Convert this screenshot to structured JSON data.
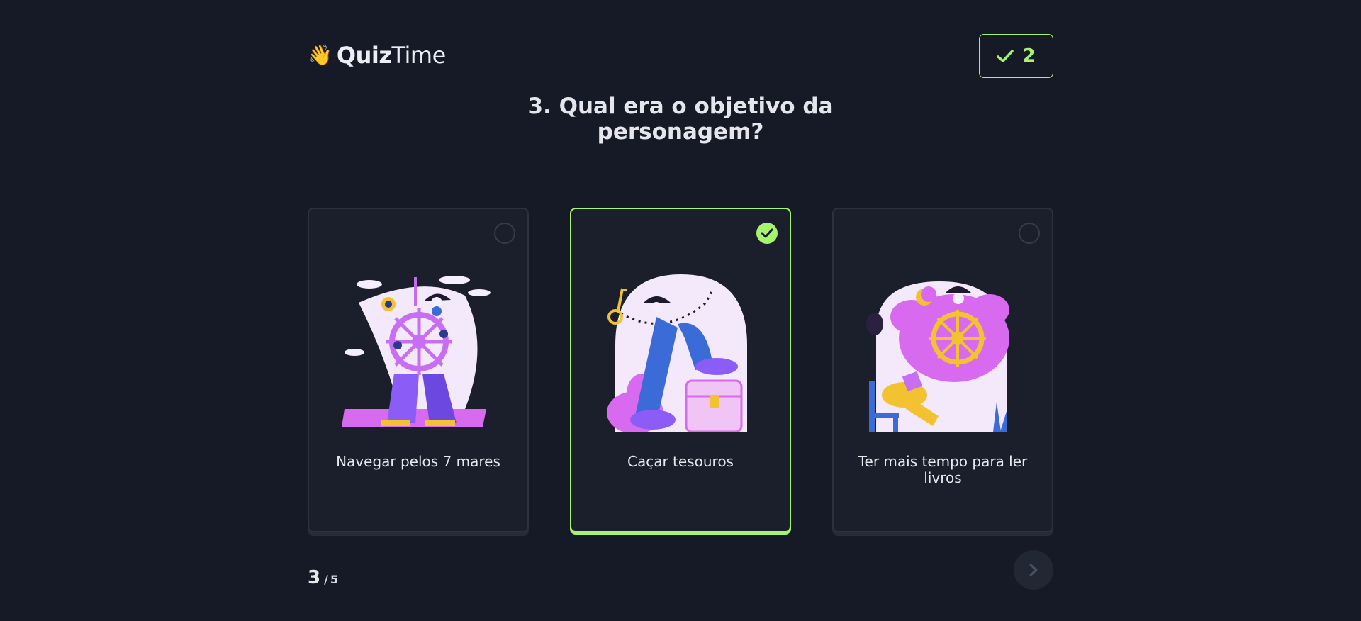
{
  "header": {
    "logo_emoji": "👋",
    "logo_bold": "Quiz",
    "logo_regular": "Time",
    "score_count": "2"
  },
  "question": {
    "text": "3. Qual era o objetivo da personagem?"
  },
  "options": [
    {
      "label": "Navegar pelos 7 mares",
      "selected": false,
      "illustration": "pirate-ship-wheel-illustration"
    },
    {
      "label": "Caçar tesouros",
      "selected": true,
      "illustration": "treasure-chest-illustration"
    },
    {
      "label": "Ter mais tempo para ler livros",
      "selected": false,
      "illustration": "reading-pirate-illustration"
    }
  ],
  "progress": {
    "current": "3",
    "separator": "/",
    "total": "5"
  },
  "icons": {
    "score": "check-icon",
    "selected": "check-circle-icon",
    "next": "chevron-right-icon"
  },
  "colors": {
    "background": "#161a26",
    "card": "#1b1f2c",
    "accent": "#a6f36e",
    "illustration_purple": "#8b5cf6",
    "illustration_pink": "#e879f9"
  }
}
